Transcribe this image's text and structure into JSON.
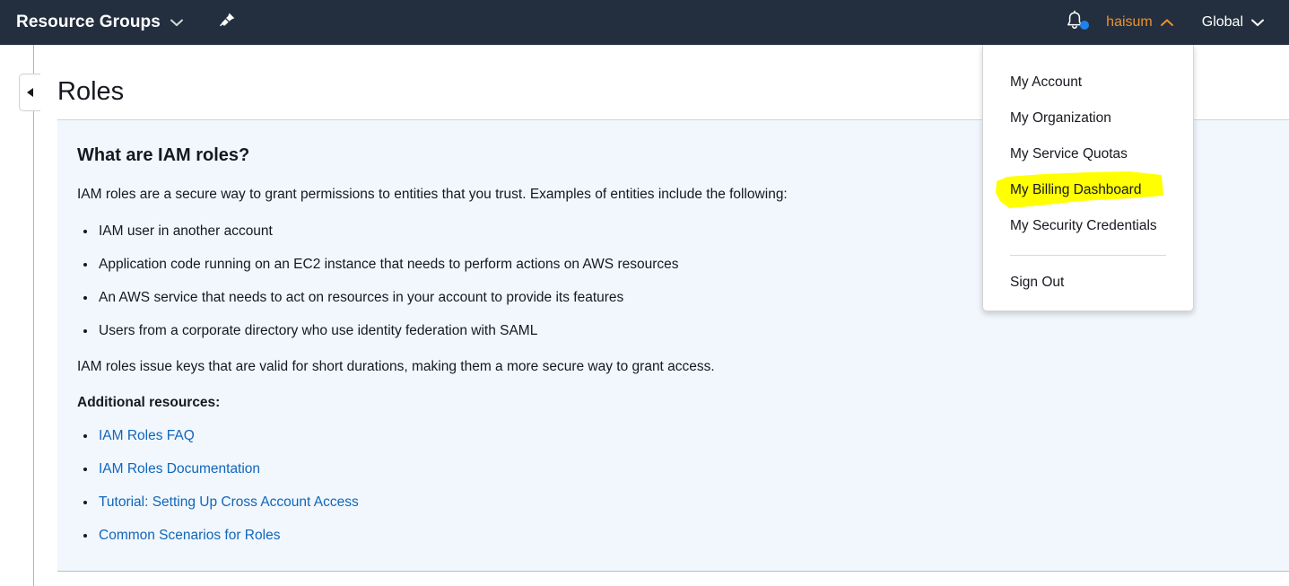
{
  "navbar": {
    "resource_groups_label": "Resource Groups",
    "resource_groups_icon": "chevron-down-icon",
    "pin_icon": "pin-icon",
    "bell_icon": "bell-icon",
    "notification_dot_color": "#1f82ea",
    "user_label": "haisum",
    "user_icon": "chevron-up-icon",
    "region_label": "Global",
    "region_icon": "chevron-down-icon",
    "background_color": "#232f3e",
    "user_text_color": "#ec912d"
  },
  "sidebar": {
    "collapse_toggle_icon": "triangle-left-icon"
  },
  "page": {
    "title": "Roles"
  },
  "info_panel": {
    "heading": "What are IAM roles?",
    "intro": "IAM roles are a secure way to grant permissions to entities that you trust. Examples of entities include the following:",
    "entity_examples": [
      "IAM user in another account",
      "Application code running on an EC2 instance that needs to perform actions on AWS resources",
      "An AWS service that needs to act on resources in your account to provide its features",
      "Users from a corporate directory who use identity federation with SAML"
    ],
    "closing": "IAM roles issue keys that are valid for short durations, making them a more secure way to grant access.",
    "resources_heading": "Additional resources:",
    "resource_links": [
      "IAM Roles FAQ",
      "IAM Roles Documentation",
      "Tutorial: Setting Up Cross Account Access",
      "Common Scenarios for Roles"
    ],
    "background_color": "#f1f7fd",
    "link_color": "#1166bb"
  },
  "account_dropdown": {
    "items": [
      "My Account",
      "My Organization",
      "My Service Quotas",
      "My Billing Dashboard",
      "My Security Credentials"
    ],
    "sign_out": "Sign Out"
  },
  "annotation": {
    "type": "highlighter",
    "color": "#ffff00",
    "target": "My Billing Dashboard"
  }
}
